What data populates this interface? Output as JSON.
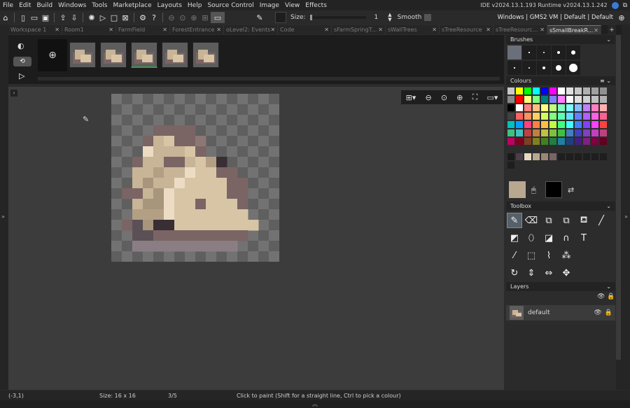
{
  "menu": [
    "File",
    "Edit",
    "Build",
    "Windows",
    "Tools",
    "Marketplace",
    "Layouts",
    "Help",
    "Source Control",
    "Image",
    "View",
    "Effects"
  ],
  "ide_version": "IDE v2024.13.1.193  Runtime v2024.13.1.242",
  "toolbar": {
    "size_label": "Size:",
    "size_value": "1",
    "smooth_label": "Smooth",
    "target": "Windows | GMS2 VM | Default | Default"
  },
  "tabs": [
    {
      "label": "Workspace 1",
      "active": false
    },
    {
      "label": "Room1",
      "active": false
    },
    {
      "label": "FarmField",
      "active": false
    },
    {
      "label": "ForestEntrance",
      "active": false
    },
    {
      "label": "oLevel2: Events",
      "active": false
    },
    {
      "label": "Code",
      "active": false
    },
    {
      "label": "sFarmSpringT...",
      "active": false
    },
    {
      "label": "sWallTrees",
      "active": false
    },
    {
      "label": "sTreeResource",
      "active": false
    },
    {
      "label": "sTreeResourc...",
      "active": false
    },
    {
      "label": "sSmallBreakR...",
      "active": true
    }
  ],
  "panels": {
    "brushes": "Brushes",
    "colours": "Colours",
    "toolbox": "Toolbox",
    "layers": "Layers"
  },
  "layer_name": "default",
  "status": {
    "coords": "(-3,1)",
    "size": "Size: 16 x 16",
    "frame": "3/5",
    "hint": "Click to paint (Shift for a straight line, Ctrl to pick a colour)"
  },
  "colors": {
    "accent_green": "#3c9a4a",
    "primary": "#b8a890",
    "secondary": "#000000"
  }
}
